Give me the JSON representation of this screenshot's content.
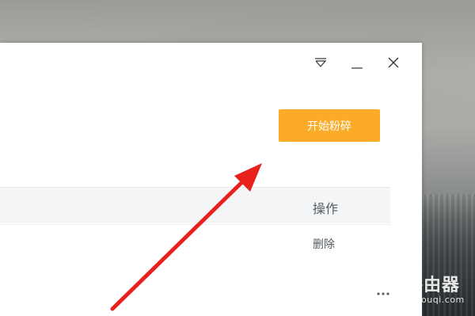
{
  "window": {
    "controls": {
      "menu_icon": "dropdown-triangle-icon",
      "minimize_icon": "minimize-icon",
      "close_icon": "close-icon"
    },
    "start_button_label": "开始粉碎",
    "table": {
      "headers": [
        "操作"
      ],
      "rows": [
        {
          "action": "删除"
        }
      ]
    }
  },
  "watermark": {
    "title": "路由器",
    "subtitle": "luyouqi.com"
  },
  "colors": {
    "accent": "#fbab27",
    "arrow": "#e8211e",
    "header_bg": "#f3f5f7",
    "text": "#555a60"
  }
}
